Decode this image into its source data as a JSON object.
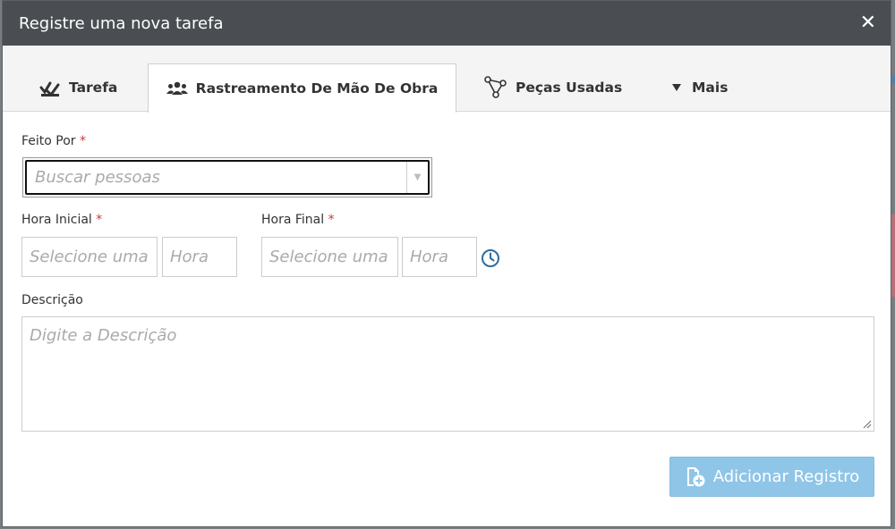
{
  "modal": {
    "title": "Registre uma nova tarefa",
    "close_icon": "close-icon"
  },
  "tabs": [
    {
      "label": "Tarefa",
      "icon": "tasks-icon"
    },
    {
      "label": "Rastreamento De Mão De Obra",
      "icon": "users-icon",
      "active": true
    },
    {
      "label": "Peças Usadas",
      "icon": "parts-icon"
    },
    {
      "label": "Mais",
      "icon": "caret-down-icon"
    }
  ],
  "form": {
    "done_by": {
      "label": "Feito Por",
      "required_mark": "*",
      "placeholder": "Buscar pessoas"
    },
    "start_time": {
      "label": "Hora Inicial",
      "required_mark": "*",
      "date_placeholder": "Selecione uma",
      "time_placeholder": "Hora"
    },
    "end_time": {
      "label": "Hora Final",
      "required_mark": "*",
      "date_placeholder": "Selecione uma",
      "time_placeholder": "Hora"
    },
    "description": {
      "label": "Descrição",
      "placeholder": "Digite a Descrição"
    },
    "submit_label": "Adicionar Registro"
  },
  "colors": {
    "header_bg": "#4a4e52",
    "submit_bg": "#8fc5e7",
    "required": "#d0343a",
    "clock_icon": "#2d6ca2"
  }
}
